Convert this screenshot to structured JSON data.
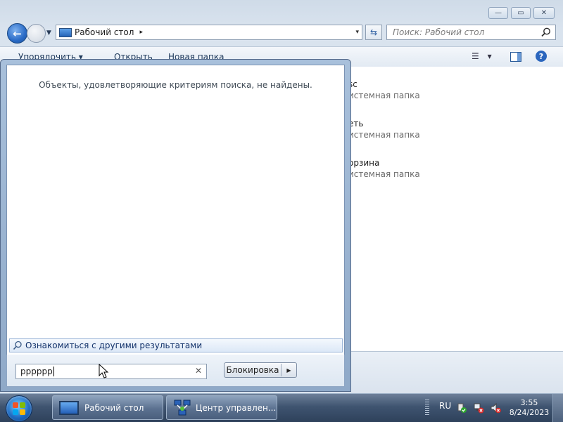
{
  "window": {
    "controls": {
      "minimize": "—",
      "maximize": "▭",
      "close": "✕"
    }
  },
  "address_bar": {
    "path": "Рабочий стол",
    "arrow": "▸",
    "dropdown": "▾"
  },
  "search": {
    "placeholder": "Поиск: Рабочий стол"
  },
  "toolbar": {
    "organize": "Упорядочить  ▾",
    "open": "Открыть",
    "new_folder": "Новая папка",
    "view": "▾"
  },
  "files": [
    {
      "name": "sc",
      "type": "истемная папка"
    },
    {
      "name": "еть",
      "type": "истемная папка"
    },
    {
      "name": "орзина",
      "type": "истемная папка"
    }
  ],
  "start_panel": {
    "no_results": "Объекты, удовлетворяющие критериям поиска, не найдены.",
    "see_more": "Ознакомиться с другими результатами",
    "search_value": "pppppp",
    "clear": "✕",
    "lock_button": "Блокировка",
    "lock_arrow": "▶"
  },
  "taskbar": {
    "buttons": [
      {
        "label": "Рабочий стол",
        "icon": "desktop-icon"
      },
      {
        "label": "Центр управлен...",
        "icon": "network-center-icon"
      }
    ],
    "tray": {
      "language": "RU",
      "time": "3:55",
      "date": "8/24/2023"
    }
  },
  "colors": {
    "accent": "#2b66be",
    "taskbar": "#3f5470",
    "link": "#12326a"
  }
}
